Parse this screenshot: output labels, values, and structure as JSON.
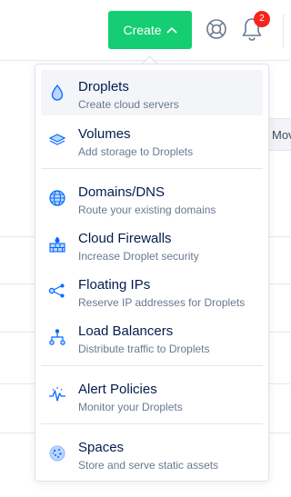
{
  "header": {
    "create_label": "Create",
    "notification_count": "2"
  },
  "background": {
    "partial_button_text": "Mov"
  },
  "menu": {
    "items": [
      {
        "title": "Droplets",
        "desc": "Create cloud servers"
      },
      {
        "title": "Volumes",
        "desc": "Add storage to Droplets"
      },
      {
        "title": "Domains/DNS",
        "desc": "Route your existing domains"
      },
      {
        "title": "Cloud Firewalls",
        "desc": "Increase Droplet security"
      },
      {
        "title": "Floating IPs",
        "desc": "Reserve IP addresses for Droplets"
      },
      {
        "title": "Load Balancers",
        "desc": "Distribute traffic to Droplets"
      },
      {
        "title": "Alert Policies",
        "desc": "Monitor your Droplets"
      },
      {
        "title": "Spaces",
        "desc": "Store and serve static assets"
      }
    ]
  },
  "colors": {
    "create_green": "#15cd72",
    "icon_blue": "#0069ff",
    "badge_red": "#f5241d"
  }
}
